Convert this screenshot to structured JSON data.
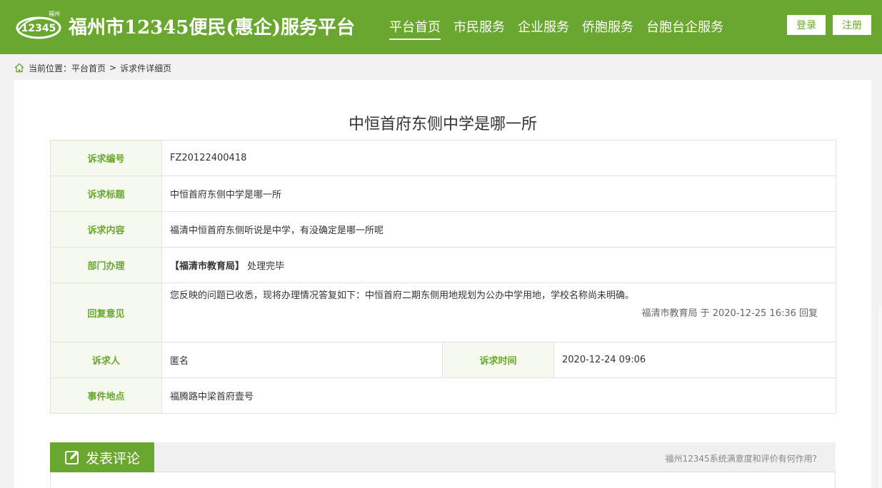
{
  "header": {
    "logo_small_text": "福州",
    "logo_number": "12345",
    "site_title": "福州市12345便民(惠企)服务平台",
    "nav": [
      {
        "label": "平台首页",
        "active": true
      },
      {
        "label": "市民服务"
      },
      {
        "label": "企业服务"
      },
      {
        "label": "侨胞服务"
      },
      {
        "label": "台胞台企服务"
      }
    ],
    "login_label": "登录",
    "register_label": "注册"
  },
  "breadcrumb": {
    "prefix": "当前位置：",
    "home": "平台首页",
    "separator": ">",
    "current": "诉求件详细页"
  },
  "page_title": "中恒首府东侧中学是哪一所",
  "details": {
    "number_label": "诉求编号",
    "number_value": "FZ20122400418",
    "title_label": "诉求标题",
    "title_value": "中恒首府东侧中学是哪一所",
    "content_label": "诉求内容",
    "content_value": "福清中恒首府东侧听说是中学，有没确定是哪一所呢",
    "dept_label": "部门办理",
    "dept_name": "【福清市教育局】",
    "dept_status": "处理完毕",
    "reply_label": "回复意见",
    "reply_text": "您反映的问题已收悉，现将办理情况答复如下：中恒首府二期东侧用地规划为公办中学用地，学校名称尚未明确。",
    "reply_meta": "福清市教育局 于 2020-12-25 16:36 回复",
    "person_label": "诉求人",
    "person_value": "匿名",
    "time_label": "诉求时间",
    "time_value": "2020-12-24 09:06",
    "location_label": "事件地点",
    "location_value": "福腾路中梁首府壹号"
  },
  "comment": {
    "tab_label": "发表评论",
    "help_link": "福州12345系统满意度和评价有何作用?"
  },
  "colors": {
    "brand_green": "#6aa731",
    "label_bg": "#f5f9ee"
  }
}
